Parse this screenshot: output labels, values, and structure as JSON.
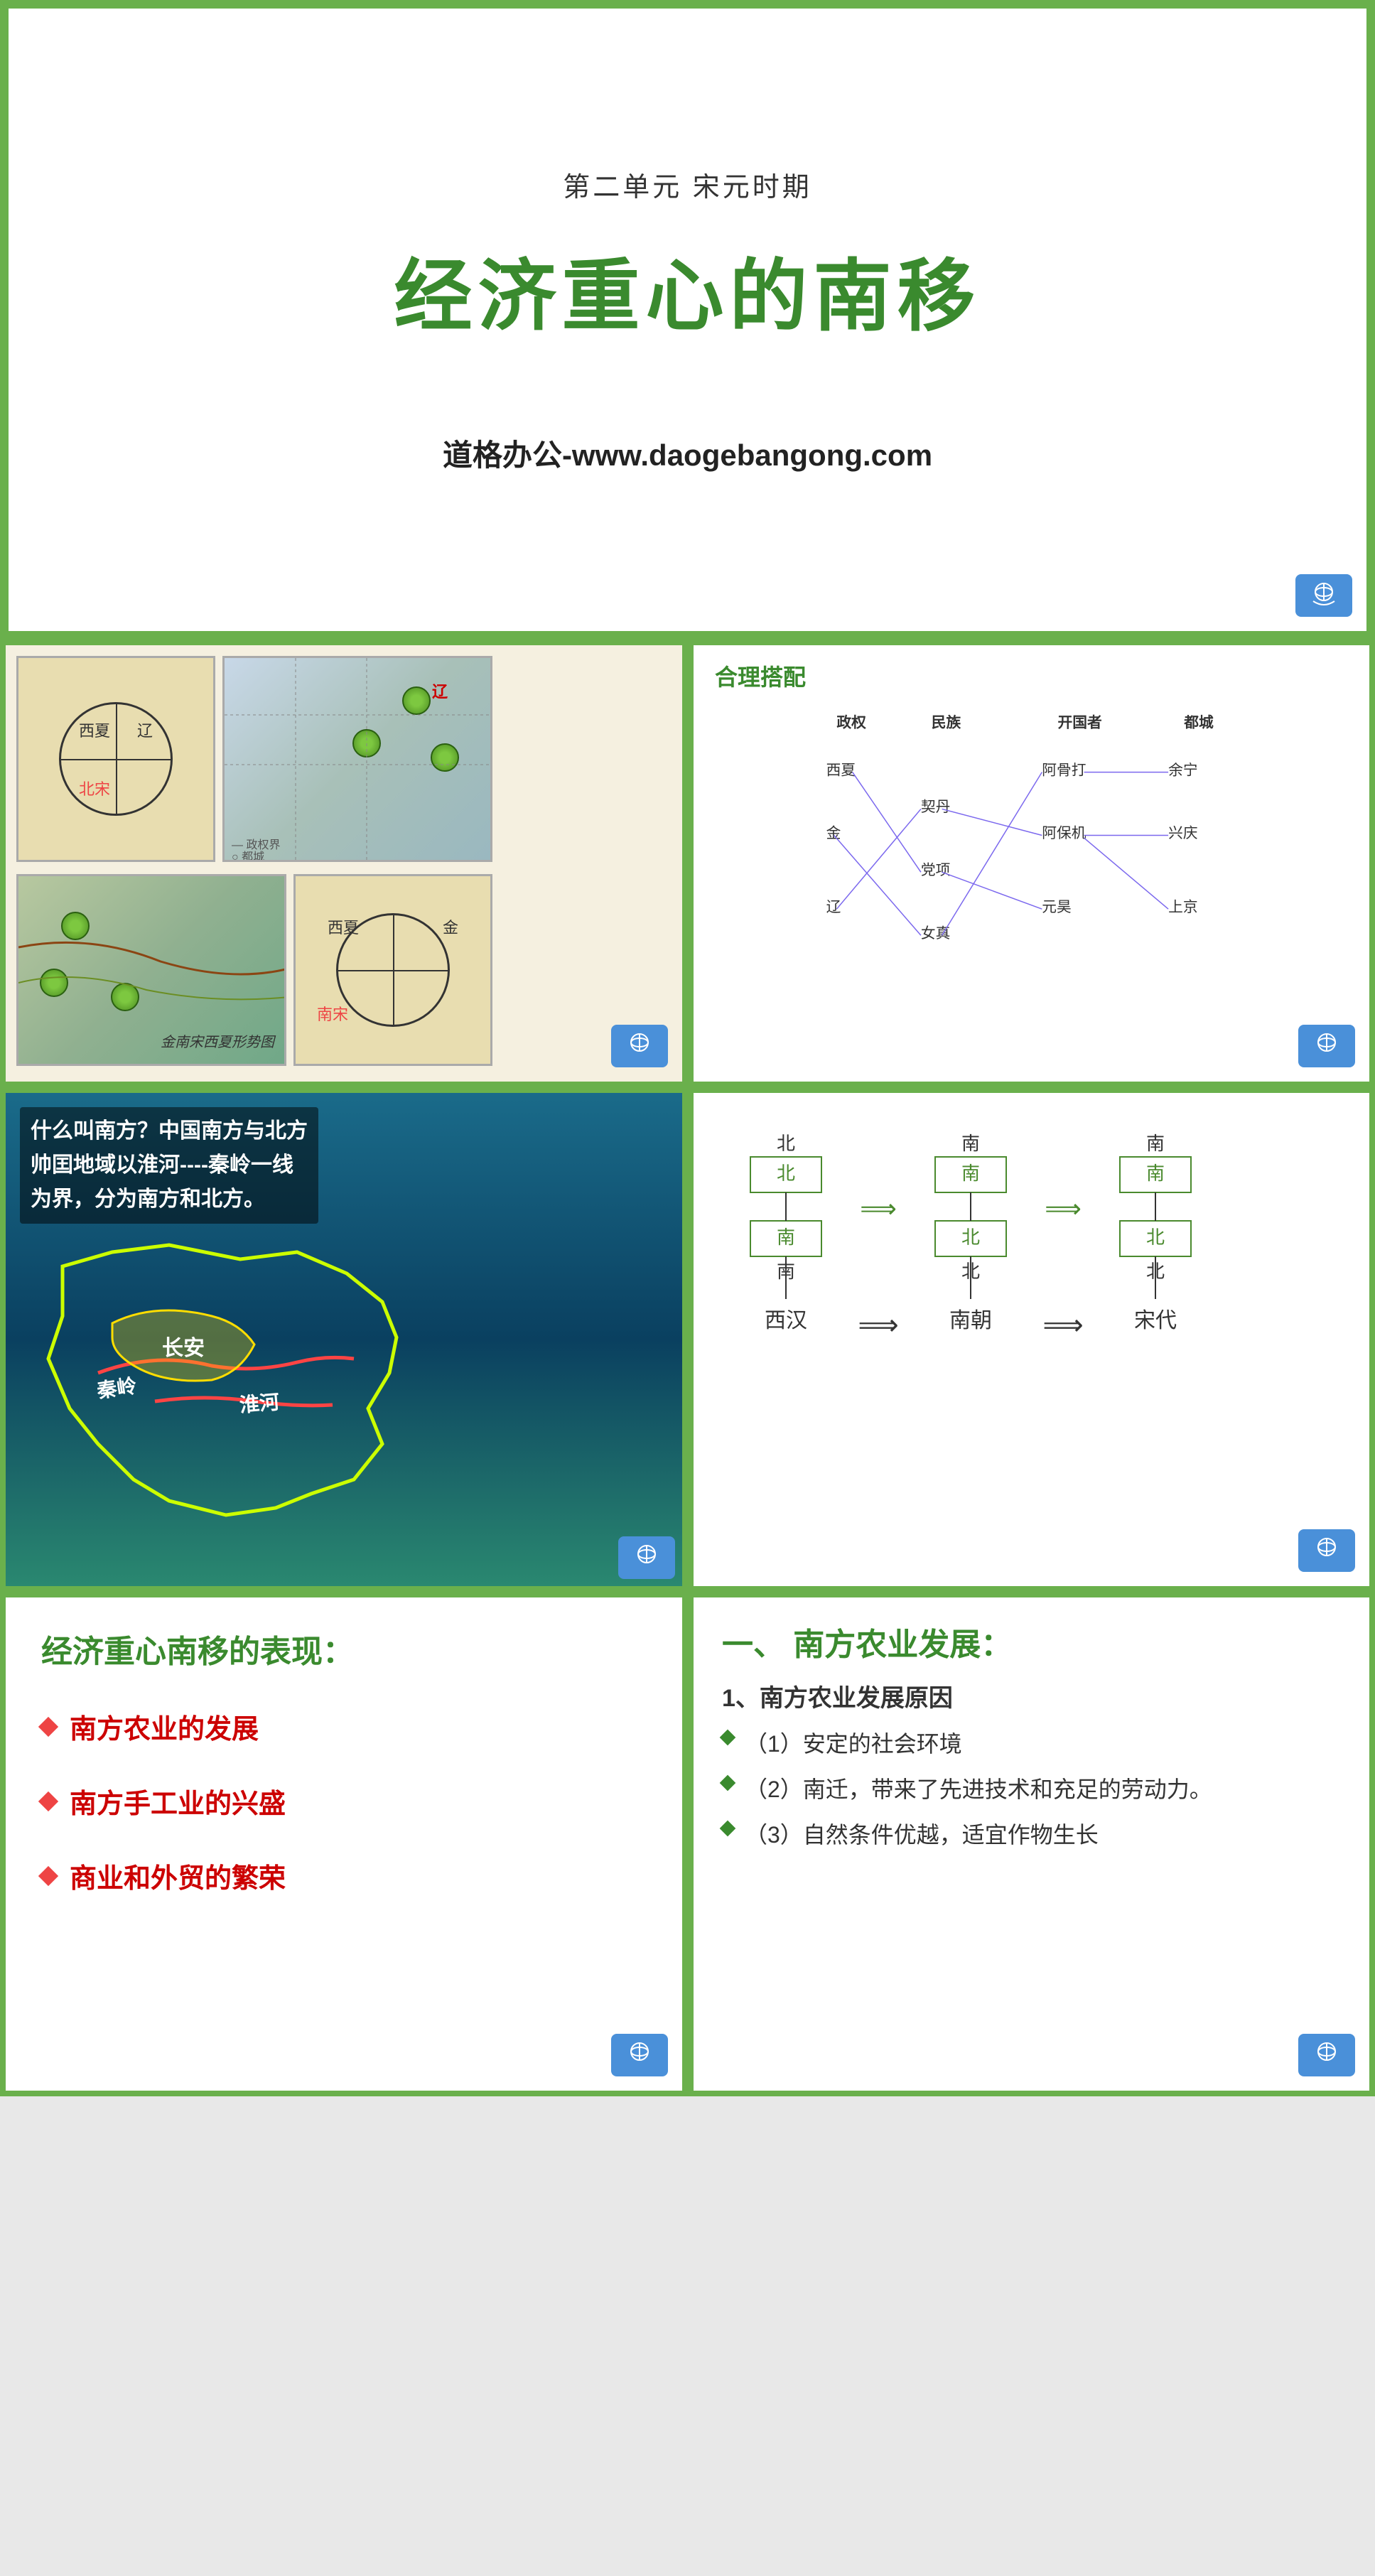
{
  "slide1": {
    "unit": "第二单元 宋元时期",
    "title": "经济重心的南移",
    "website": "道格办公-www.daogebangong.com"
  },
  "slide2": {
    "circle1": {
      "tl": "西夏",
      "tr": "辽",
      "bl": "北宋",
      "br": ""
    },
    "liao_label": "辽",
    "circle2": {
      "tl": "西夏",
      "tr": "金",
      "bl": "南宋"
    }
  },
  "slide3": {
    "title": "合理搭配",
    "headers": [
      "政权",
      "民族",
      "开国者",
      "都城"
    ],
    "rows": [
      [
        "西夏",
        "契丹",
        "阿骨打",
        "余宁"
      ],
      [
        "金",
        "党项",
        "阿保机",
        "兴庆"
      ],
      [
        "辽",
        "女真",
        "元昊",
        "上京"
      ]
    ]
  },
  "slide4": {
    "text_line1": "什么叫南方？中国南方与北方",
    "text_line2": "帅囯地域以淮河----秦岭一线",
    "text_line3": "为界，分为南方和北方。",
    "label_changan": "长安",
    "label_qinling": "秦岭",
    "label_huaihe": "淮河"
  },
  "slide5": {
    "periods": [
      "西汉",
      "南朝",
      "宋代"
    ],
    "north_label": "北",
    "south_label": "南",
    "arrow": "⟹"
  },
  "slide6": {
    "title": "经济重心南移的表现：",
    "items": [
      "南方农业的发展",
      "南方手工业的兴盛",
      "商业和外贸的繁荣"
    ]
  },
  "slide7": {
    "title_prefix": "一、",
    "title_main": "南方农业发展：",
    "numbered": "1、南方农业发展原因",
    "bullets": [
      "（1）安定的社会环境",
      "（2）南迁，带来了先进技术和充足的劳动力。",
      "（3）自然条件优越，适宜作物生长"
    ]
  },
  "colors": {
    "green_border": "#6ab04c",
    "green_text": "#3a8a2e",
    "red_text": "#cc0000",
    "dark": "#333333"
  }
}
